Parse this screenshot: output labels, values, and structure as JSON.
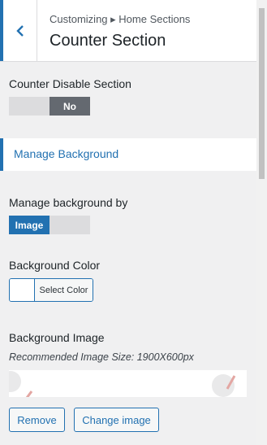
{
  "header": {
    "breadcrumb": "Customizing ▸ Home Sections",
    "title": "Counter Section"
  },
  "counter_disable": {
    "label": "Counter Disable Section",
    "toggle": {
      "selected": "No",
      "options": [
        "",
        "No"
      ]
    }
  },
  "manage_background_link": "Manage Background",
  "manage_background_by": {
    "label": "Manage background by",
    "toggle": {
      "selected": "Image",
      "options": [
        "Image",
        ""
      ]
    }
  },
  "background_color": {
    "label": "Background Color",
    "button": "Select Color"
  },
  "background_image": {
    "label": "Background Image",
    "help": "Recommended Image Size: 1900X600px",
    "remove_button": "Remove",
    "change_button": "Change image"
  },
  "colors": {
    "accent": "#2271b1",
    "toggle_active": "#646970",
    "toggle_inactive": "#dcdcde"
  }
}
